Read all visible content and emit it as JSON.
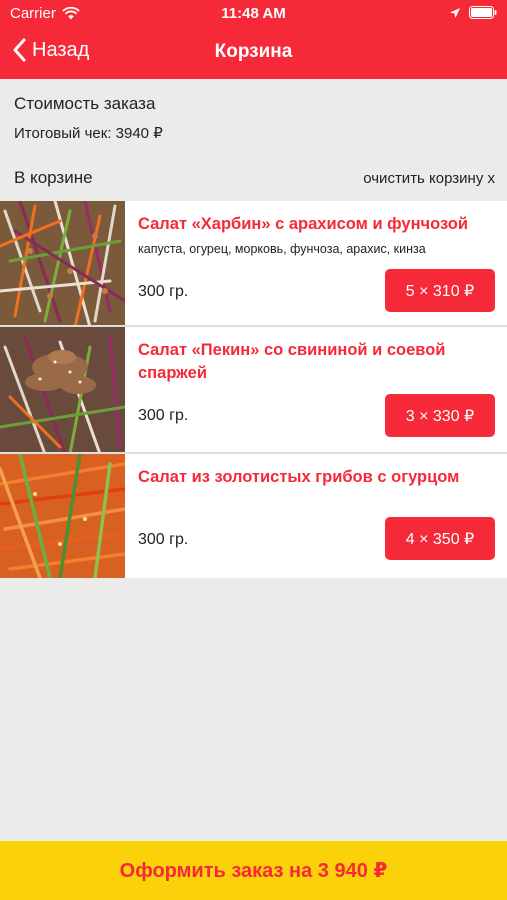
{
  "status_bar": {
    "carrier": "Carrier",
    "time": "11:48 AM"
  },
  "nav": {
    "back_label": "Назад",
    "title": "Корзина"
  },
  "summary": {
    "title": "Стоимость заказа",
    "total": "Итоговый чек: 3940 ₽"
  },
  "cart": {
    "title": "В корзине",
    "clear_label": "очистить корзину x"
  },
  "items": [
    {
      "name": "Салат «Харбин» с арахисом и фунчозой",
      "description": "капуста, огурец, морковь, фунчоза, арахис, кинза",
      "weight": "300 гр.",
      "price": "5 × 310 ₽"
    },
    {
      "name": "Салат «Пекин» со свининой и соевой спаржей",
      "description": "",
      "weight": "300 гр.",
      "price": "3 × 330 ₽"
    },
    {
      "name": "Салат из золотистых грибов с огурцом",
      "description": "",
      "weight": "300 гр.",
      "price": "4 × 350 ₽"
    }
  ],
  "checkout": {
    "label": "Оформить заказ на 3 940 ₽"
  },
  "colors": {
    "brand_red": "#f62938",
    "checkout_yellow": "#fbd20a",
    "background": "#ebebeb"
  }
}
